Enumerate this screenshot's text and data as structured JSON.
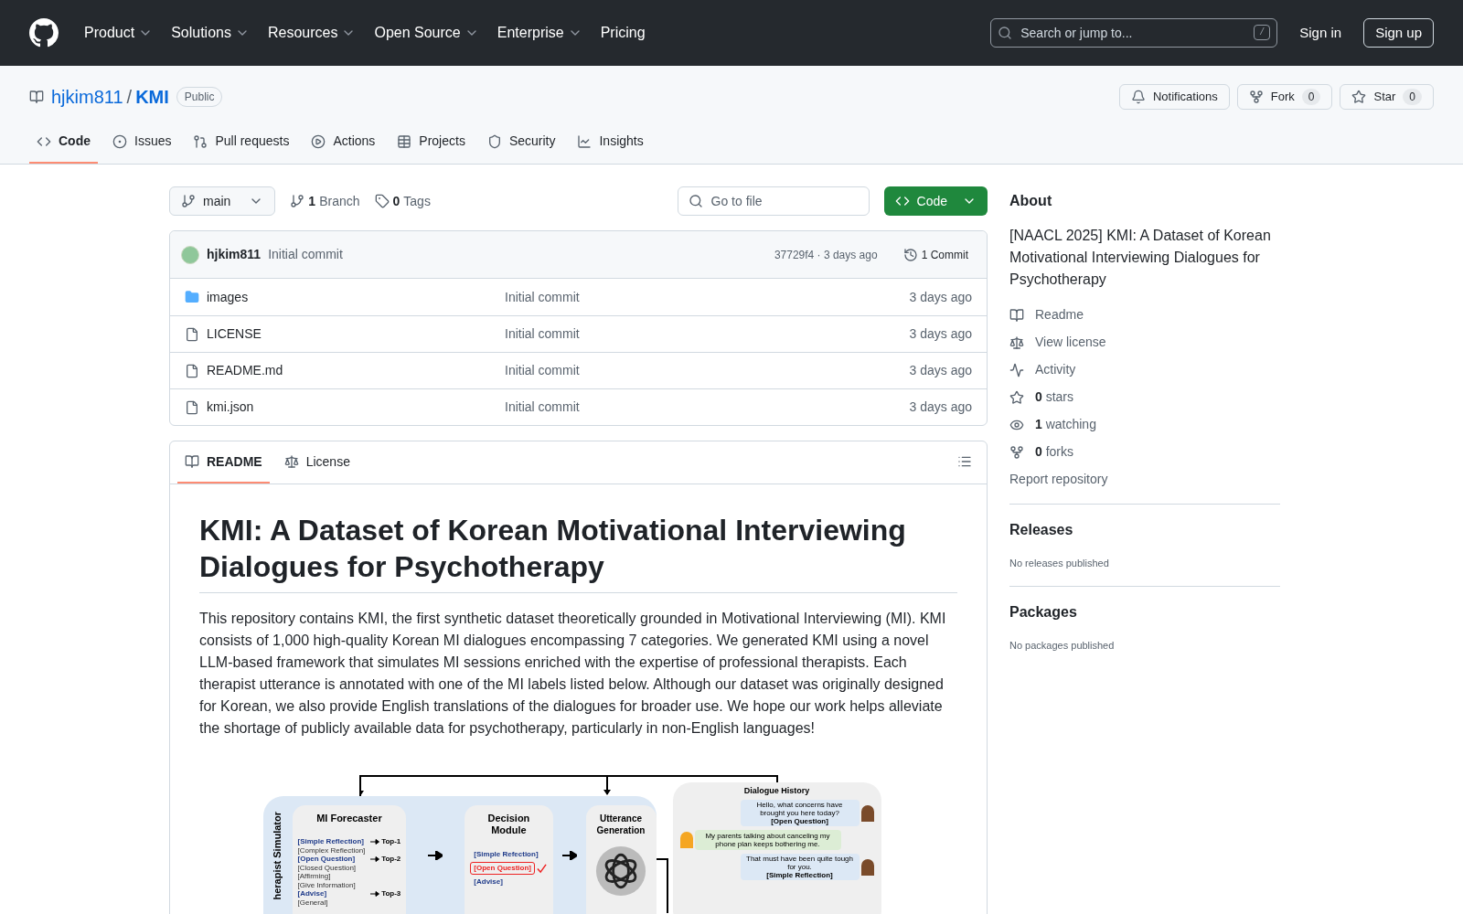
{
  "header": {
    "nav": [
      {
        "label": "Product",
        "dropdown": true
      },
      {
        "label": "Solutions",
        "dropdown": true
      },
      {
        "label": "Resources",
        "dropdown": true
      },
      {
        "label": "Open Source",
        "dropdown": true
      },
      {
        "label": "Enterprise",
        "dropdown": true
      },
      {
        "label": "Pricing",
        "dropdown": false
      }
    ],
    "search": {
      "placeholder": "Search or jump to...",
      "shortcut": "/"
    },
    "sign_in": "Sign in",
    "sign_up": "Sign up"
  },
  "repo": {
    "owner": "hjkim811",
    "separator": "/",
    "name": "KMI",
    "visibility": "Public",
    "actions": [
      {
        "kind": "notifications",
        "label": "Notifications"
      },
      {
        "kind": "fork",
        "label": "Fork",
        "count": "0"
      },
      {
        "kind": "star",
        "label": "Star",
        "count": "0"
      }
    ]
  },
  "tabs": [
    {
      "kind": "code",
      "label": "Code",
      "selected": true
    },
    {
      "kind": "issues",
      "label": "Issues",
      "selected": false
    },
    {
      "kind": "pulls",
      "label": "Pull requests",
      "selected": false
    },
    {
      "kind": "actions",
      "label": "Actions",
      "selected": false
    },
    {
      "kind": "projects",
      "label": "Projects",
      "selected": false
    },
    {
      "kind": "security",
      "label": "Security",
      "selected": false
    },
    {
      "kind": "insights",
      "label": "Insights",
      "selected": false
    }
  ],
  "toolbar": {
    "branch": "main",
    "branches_count": "1",
    "branches_label": "Branch",
    "tags_count": "0",
    "tags_label": "Tags",
    "go_to_file": {
      "placeholder": "Go to file"
    },
    "code_button": "Code"
  },
  "commit": {
    "author": "hjkim811",
    "message": "Initial commit",
    "hash_time": "37729f4 · 3 days ago",
    "commits": "1 Commit"
  },
  "files": [
    {
      "kind": "folder",
      "name": "images",
      "message": "Initial commit",
      "time": "3 days ago"
    },
    {
      "kind": "file",
      "name": "LICENSE",
      "message": "Initial commit",
      "time": "3 days ago"
    },
    {
      "kind": "file",
      "name": "README.md",
      "message": "Initial commit",
      "time": "3 days ago"
    },
    {
      "kind": "file",
      "name": "kmi.json",
      "message": "Initial commit",
      "time": "3 days ago"
    }
  ],
  "readme": {
    "tabs": [
      {
        "kind": "readme",
        "label": "README",
        "selected": true
      },
      {
        "kind": "license",
        "label": "License",
        "selected": false
      }
    ],
    "title": "KMI: A Dataset of Korean Motivational Interviewing Dialogues for Psychotherapy",
    "paragraph": "This repository contains KMI, the first synthetic dataset theoretically grounded in Motivational Interviewing (MI). KMI consists of 1,000 high-quality Korean MI dialogues encompassing 7 categories. We generated KMI using a novel LLM-based framework that simulates MI sessions enriched with the expertise of professional therapists. Each therapist utterance is annotated with one of the MI labels listed below. Although our dataset was originally designed for Korean, we also provide English translations of the dialogues for broader use. We hope our work helps alleviate the shortage of publicly available data for psychotherapy, particularly in non-English languages!",
    "figure": {
      "side_label": "herapist Simulator",
      "forecaster": {
        "title": "MI Forecaster",
        "labels": [
          {
            "text": "[Simple Reflection]",
            "highlighted": true,
            "rank": "Top-1"
          },
          {
            "text": "[Complex Reflection]",
            "highlighted": false
          },
          {
            "text": "[Open Question]",
            "highlighted": true,
            "rank": "Top-2"
          },
          {
            "text": "[Closed Question]",
            "highlighted": false
          },
          {
            "text": "[Affirming]",
            "highlighted": false
          },
          {
            "text": "[Give Information]",
            "highlighted": false
          },
          {
            "text": "[Advise]",
            "highlighted": true,
            "rank": "Top-3"
          },
          {
            "text": "[General]",
            "highlighted": false
          }
        ]
      },
      "decision": {
        "title": "Decision Module",
        "options": [
          {
            "text": "[Simple Refection]",
            "selected": false
          },
          {
            "text": "[Open Question]",
            "selected": true
          },
          {
            "text": "[Advise]",
            "selected": false
          }
        ]
      },
      "generation": {
        "title": "Utterance Generation"
      },
      "history": {
        "title": "Dialogue History",
        "messages": [
          {
            "kind": "therapist",
            "text": "Hello, what concerns have brought you here today?",
            "label": "[Open Question]"
          },
          {
            "kind": "client",
            "text": "My parents talking about canceling my phone plan keeps bothering me."
          },
          {
            "kind": "therapist",
            "text": "That must have been quite tough for you.",
            "label": "[Simple Reflection]"
          }
        ]
      }
    }
  },
  "about": {
    "title": "About",
    "description": "[NAACL 2025] KMI: A Dataset of Korean Motivational Interviewing Dialogues for Psychotherapy",
    "links": [
      {
        "kind": "readme",
        "label": "Readme"
      },
      {
        "kind": "license",
        "label": "View license"
      },
      {
        "kind": "activity",
        "label": "Activity"
      },
      {
        "kind": "stars",
        "count": "0",
        "label": "stars"
      },
      {
        "kind": "watching",
        "count": "1",
        "label": "watching"
      },
      {
        "kind": "forks",
        "count": "0",
        "label": "forks"
      }
    ],
    "report": "Report repository"
  },
  "releases": {
    "title": "Releases",
    "note": "No releases published"
  },
  "packages": {
    "title": "Packages",
    "note": "No packages published"
  }
}
